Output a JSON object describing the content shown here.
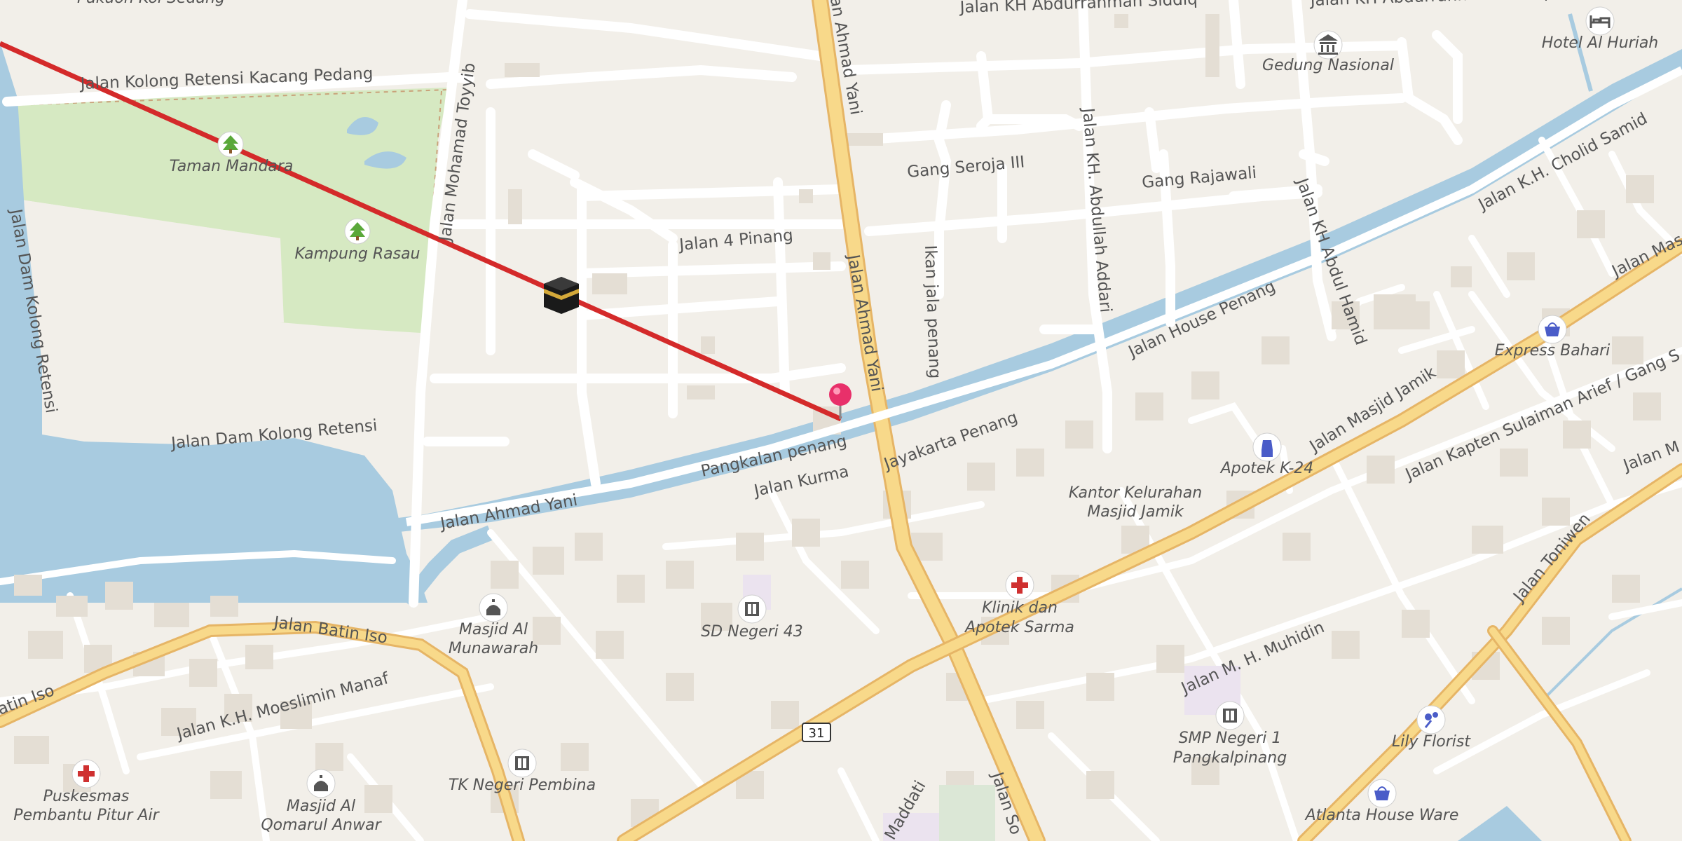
{
  "map": {
    "streets": {
      "kolong_kacang": "Jalan Kolong Retensi Kacang Pedang",
      "dam_kolong_retensi_v": "Jalan Dam Kolong Retensi",
      "dam_kolong_retensi": "Jalan Dam Kolong Retensi",
      "mohamad_toyyib": "Jalan Mohamad Toyyib",
      "abdurrahman_1": "Jalan KH Abdurrahman Siddiq",
      "abdurrahman_2": "Jalan KH Abdurrahman Siddiq",
      "ahmad_yani_top": "Jalan Ahmad Yani",
      "ahmad_yani_v": "Jalan Ahmad Yani",
      "ahmad_yani_w": "Jalan Ahmad Yani",
      "gang_seroja": "Gang Seroja III",
      "gang_rajawali": "Gang Rajawali",
      "jalan_4_pinang": "Jalan 4 Pinang",
      "ikan_jala": "Ikan jala penang",
      "abdullah_addari": "Jalan KH. Abdullah Addari",
      "abdul_hamid": "Jalan KH Abdul Hamid",
      "cholid_samid": "Jalan K.H. Cholid Samid",
      "jalan_mas": "Jalan Mas",
      "house_penang": "Jalan House Penang",
      "pangkalan_penang": "Pangkalan penang",
      "jalan_kurma": "Jalan Kurma",
      "jayakarta": "Jayakarta Penang",
      "masjid_jamik": "Jalan Masjid Jamik",
      "kapten_sulaiman": "Jalan Kapten Sulaiman Arief / Gang S",
      "jalan_m": "Jalan M",
      "toniwen": "Jalan Toniwen",
      "batin_iso": "Jalan Batin Iso",
      "batin_iso_left": "atin Iso",
      "moeslimin": "Jalan K.H. Moeslimin Manaf",
      "mh_muhidin": "Jalan M. H. Muhidin",
      "maddati": "Maddati",
      "jalan_so": "Jalan So"
    },
    "route_shield": "31",
    "pois": {
      "taman_mandara": "Taman Mandara",
      "kampung_rasau": "Kampung Rasau",
      "gedung_nasional": "Gedung Nasional",
      "hotel_al_huriah": "Hotel Al Huriah",
      "express_bahari": "Express Bahari",
      "apotek_k24": "Apotek K-24",
      "kantor_kelurahan_1": "Kantor Kelurahan",
      "kantor_kelurahan_2": "Masjid Jamik",
      "klinik_1": "Klinik dan",
      "klinik_2": "Apotek Sarma",
      "sd_negeri_43": "SD Negeri 43",
      "masjid_munawarah_1": "Masjid Al",
      "masjid_munawarah_2": "Munawarah",
      "puskesmas_1": "Puskesmas",
      "puskesmas_2": "Pembantu Pitur Air",
      "masjid_qomarul_1": "Masjid Al",
      "masjid_qomarul_2": "Qomarul Anwar",
      "tk_negeri_pembina": "TK Negeri Pembina",
      "smp_negeri_1_1": "SMP Negeri 1",
      "smp_negeri_1_2": "Pangkalpinang",
      "lily_florist": "Lily Florist",
      "atlanta_house_ware": "Atlanta House Ware",
      "top_left_partial": "Pakuon Kol Sedang"
    },
    "colors": {
      "background": "#f2efe9",
      "water": "#a8cbe0",
      "park": "#d6e9c2",
      "major_road": "#f8d98a",
      "route_line": "#d42a2a",
      "pin": "#e8306a"
    }
  }
}
